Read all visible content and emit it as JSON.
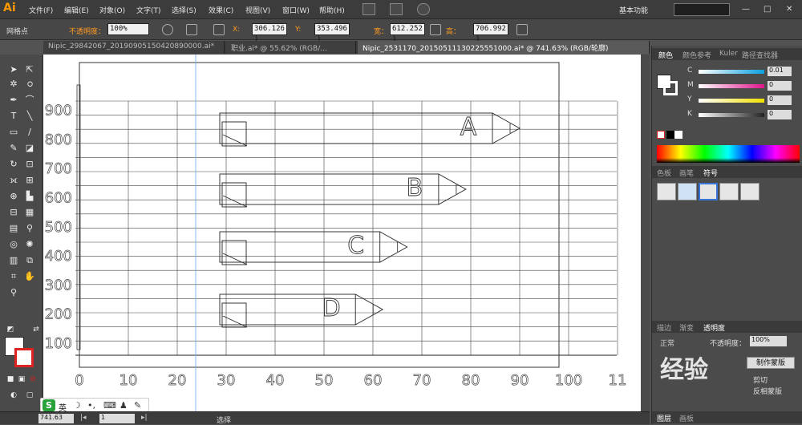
{
  "app": {
    "logo": "Ai",
    "accent": "#ff9a00"
  },
  "menubar": {
    "items": [
      "文件(F)",
      "编辑(E)",
      "对象(O)",
      "文字(T)",
      "选择(S)",
      "效果(C)",
      "视图(V)",
      "窗口(W)",
      "帮助(H)"
    ],
    "workspace": "基本功能",
    "window_controls": [
      "—",
      "□",
      "✕"
    ]
  },
  "control_bar": {
    "mode_label": "网格点",
    "opacity_label": "不透明度：",
    "opacity_value": "100%",
    "x_label": "X:",
    "x_value": "306.126 )",
    "y_label": "Y:",
    "y_value": "353.496 )",
    "w_label": "宽：",
    "w_value": "612.252 )",
    "h_label": "高：",
    "h_value": "706.992 )"
  },
  "tabs": [
    {
      "label": "Nipic_29842067_20190905150420890000.ai*",
      "active": false
    },
    {
      "label": "职业.ai* @ 55.62% (RGB/...",
      "active": false
    },
    {
      "label": "Nipic_2531170_20150511130225551000.ai* @ 741.63% (RGB/轮廓)",
      "active": true
    }
  ],
  "status": {
    "zoom": "741.63",
    "page": "1",
    "tool_text": "选择"
  },
  "ime": {
    "lang": "英",
    "logo": "S"
  },
  "right_panel": {
    "color_tabs": [
      "颜色",
      "颜色参考",
      "Kuler",
      "路径查找器"
    ],
    "channels": [
      {
        "name": "C",
        "value": "0.01",
        "gradient": "#0aa0e0"
      },
      {
        "name": "M",
        "value": "0",
        "gradient": "#e0148c"
      },
      {
        "name": "Y",
        "value": "0",
        "gradient": "#f0e000"
      },
      {
        "name": "K",
        "value": "0",
        "gradient": "#222222"
      }
    ],
    "symbol_tabs": [
      "色板",
      "画笔",
      "符号"
    ],
    "bottom_tabs": [
      "描边",
      "渐变",
      "透明度"
    ],
    "blend_mode": "正常",
    "opacity_label": "不透明度：",
    "opacity_value": "100%",
    "mask_button": "制作蒙版",
    "clip_label": "剪切",
    "invert_label": "反相蒙版",
    "layer_tabs": [
      "图层",
      "画板"
    ]
  },
  "watermark": "经验",
  "chart_data": {
    "type": "bar",
    "orientation": "horizontal",
    "categories": [
      "A",
      "B",
      "C",
      "D"
    ],
    "values": [
      90,
      79,
      67,
      62
    ],
    "x_ticks": [
      "0",
      "10",
      "20",
      "30",
      "40",
      "50",
      "60",
      "70",
      "80",
      "90",
      "100",
      "11"
    ],
    "y_ticks": [
      "100",
      "200",
      "300",
      "400",
      "500",
      "600",
      "700",
      "800",
      "900"
    ],
    "xlim": [
      0,
      110
    ],
    "grid": true,
    "style": "pencil-outline"
  }
}
